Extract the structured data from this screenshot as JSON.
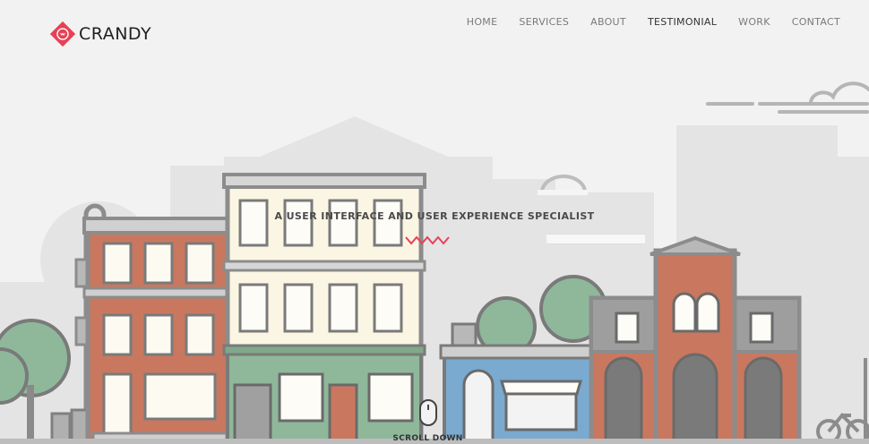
{
  "brand": {
    "name": "CRANDY",
    "color": "#e84054"
  },
  "nav": {
    "items": [
      {
        "label": "HOME"
      },
      {
        "label": "SERVICES"
      },
      {
        "label": "ABOUT"
      },
      {
        "label": "TESTIMONIAL",
        "active": true
      },
      {
        "label": "WORK"
      },
      {
        "label": "CONTACT"
      }
    ]
  },
  "hero": {
    "tagline": "A USER INTERFACE AND USER EXPERIENCE SPECIALIST",
    "accent_icon": "zigzag-divider",
    "scroll_label": "SCROLL DOWN",
    "scroll_icon": "mouse-icon"
  },
  "colors": {
    "background": "#f2f2f2",
    "accent": "#e84054",
    "brick": "#c9785f",
    "cream": "#fbf6e4",
    "green": "#8fb89a",
    "blue": "#7aaad0",
    "outline": "#8c8c8c"
  }
}
